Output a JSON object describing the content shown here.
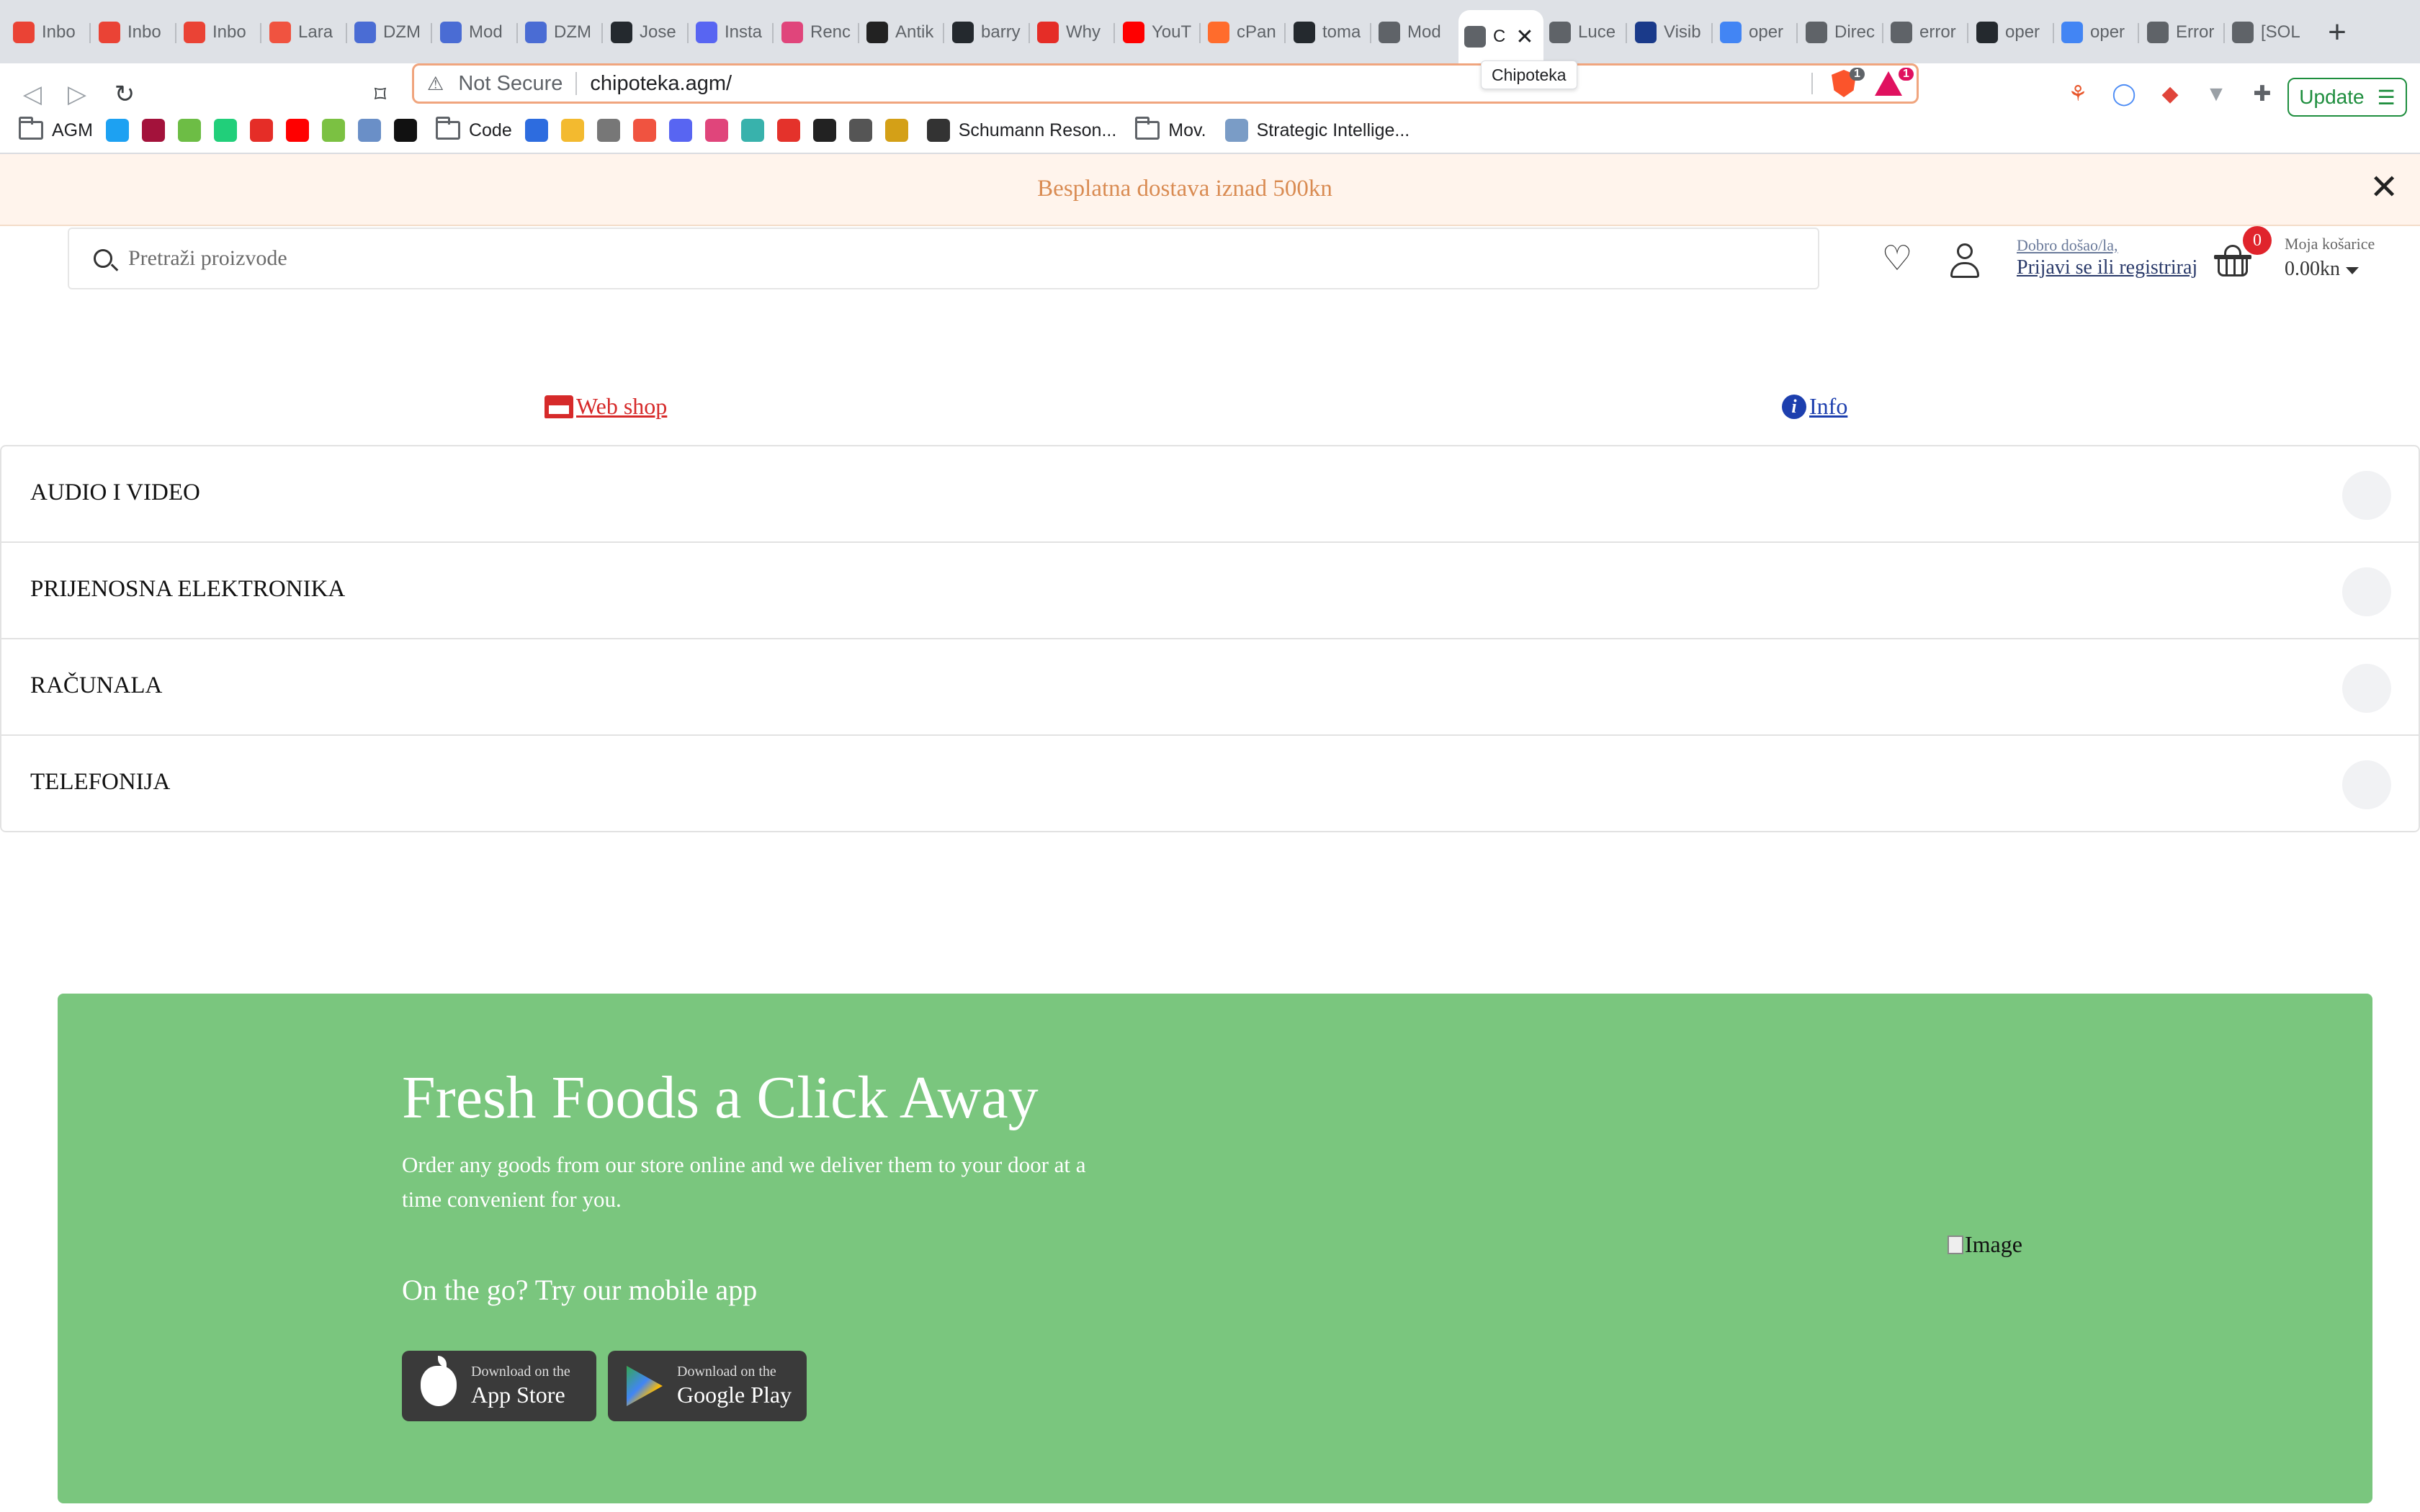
{
  "browser": {
    "tabs": [
      {
        "label": "Inbo",
        "icon": "gmail-icon",
        "color": "#ea4335"
      },
      {
        "label": "Inbo",
        "icon": "gmail-icon",
        "color": "#ea4335"
      },
      {
        "label": "Inbo",
        "icon": "gmail-icon",
        "color": "#ea4335"
      },
      {
        "label": "Lara",
        "icon": "laravel-icon",
        "color": "#f05340"
      },
      {
        "label": "DZM",
        "icon": "stack-icon",
        "color": "#4a6cd4"
      },
      {
        "label": "Mod",
        "icon": "stack-icon",
        "color": "#4a6cd4"
      },
      {
        "label": "DZM",
        "icon": "stack-icon",
        "color": "#4a6cd4"
      },
      {
        "label": "Jose",
        "icon": "github-icon",
        "color": "#24292e"
      },
      {
        "label": "Insta",
        "icon": "planet-icon",
        "color": "#5865f2"
      },
      {
        "label": "Renc",
        "icon": "balloon-icon",
        "color": "#e0457b"
      },
      {
        "label": "Antik",
        "icon": "chart-icon",
        "color": "#222222"
      },
      {
        "label": "barry",
        "icon": "github-icon",
        "color": "#24292e"
      },
      {
        "label": "Why",
        "icon": "c-icon",
        "color": "#e52d27"
      },
      {
        "label": "YouT",
        "icon": "youtube-icon",
        "color": "#ff0000"
      },
      {
        "label": "cPan",
        "icon": "cpanel-icon",
        "color": "#ff6c2c"
      },
      {
        "label": "toma",
        "icon": "github-icon",
        "color": "#24292e"
      },
      {
        "label": "Mod",
        "icon": "globe-icon",
        "color": "#5f6368"
      },
      {
        "label": "C",
        "icon": "cart-icon",
        "color": "#5f6368",
        "active": true
      },
      {
        "label": "Luce",
        "icon": "globe-icon",
        "color": "#5f6368"
      },
      {
        "label": "Visib",
        "icon": "f-icon",
        "color": "#1a3a8a"
      },
      {
        "label": "oper",
        "icon": "google-icon",
        "color": "#4285f4"
      },
      {
        "label": "Direc",
        "icon": "globe-icon",
        "color": "#5f6368"
      },
      {
        "label": "error",
        "icon": "globe-icon",
        "color": "#5f6368"
      },
      {
        "label": "oper",
        "icon": "github-icon",
        "color": "#24292e"
      },
      {
        "label": "oper",
        "icon": "google-icon",
        "color": "#4285f4"
      },
      {
        "label": "Error",
        "icon": "globe-icon",
        "color": "#5f6368"
      },
      {
        "label": "[SOL",
        "icon": "globe-icon",
        "color": "#5f6368"
      }
    ],
    "tooltip": "Chipoteka",
    "security_label": "Not Secure",
    "url": "chipoteka.agm/",
    "brave_shield_count": "1",
    "brave_rewards_count": "1",
    "update_label": "Update",
    "bookmarks": [
      {
        "label": "AGM",
        "icon": "folder-icon"
      },
      {
        "label": "",
        "icon": "twitter-icon",
        "color": "#1da1f2"
      },
      {
        "label": "",
        "icon": "gem-icon",
        "color": "#a3123b"
      },
      {
        "label": "",
        "icon": "g-icon",
        "color": "#6dbd45"
      },
      {
        "label": "",
        "icon": "gab-icon",
        "color": "#21cf7a"
      },
      {
        "label": "",
        "icon": "c-icon",
        "color": "#e52d27"
      },
      {
        "label": "",
        "icon": "youtube-icon",
        "color": "#ff0000"
      },
      {
        "label": "",
        "icon": "play-icon",
        "color": "#7bc142"
      },
      {
        "label": "",
        "icon": "globe-icon",
        "color": "#6a8fc7"
      },
      {
        "label": "",
        "icon": "theta-icon",
        "color": "#111111"
      },
      {
        "label": "Code",
        "icon": "folder-icon"
      },
      {
        "label": "",
        "icon": "c-icon",
        "color": "#2d6cdf"
      },
      {
        "label": "",
        "icon": "binance-icon",
        "color": "#f3ba2f"
      },
      {
        "label": "",
        "icon": "stack-icon",
        "color": "#777777"
      },
      {
        "label": "",
        "icon": "laravel-icon",
        "color": "#f05340"
      },
      {
        "label": "",
        "icon": "planet-icon",
        "color": "#5865f2"
      },
      {
        "label": "",
        "icon": "balloon-icon",
        "color": "#e0457b"
      },
      {
        "label": "",
        "icon": "tailwind-icon",
        "color": "#38b2ac"
      },
      {
        "label": "",
        "icon": "in-icon",
        "color": "#e4322b"
      },
      {
        "label": "",
        "icon": "printer-icon",
        "color": "#222222"
      },
      {
        "label": "",
        "icon": "pin-icon",
        "color": "#555555"
      },
      {
        "label": "",
        "icon": "link-icon",
        "color": "#d4a017"
      },
      {
        "label": "Schumann Reson...",
        "icon": "mercedes-icon",
        "color": "#333333"
      },
      {
        "label": "Mov.",
        "icon": "folder-icon"
      },
      {
        "label": "Strategic Intellige...",
        "icon": "wave-icon",
        "color": "#7a9cc6"
      }
    ]
  },
  "promo": {
    "text": "Besplatna dostava iznad 500kn",
    "color": "#d98b52",
    "background": "#fff4ec"
  },
  "header": {
    "search_placeholder": "Pretraži proizvode",
    "welcome": "Dobro došao/la,",
    "login": "Prijavi se ili registriraj",
    "cart_count": "0",
    "cart_label": "Moja košarice",
    "cart_total": "0.00kn"
  },
  "nav": {
    "shop": "Web shop",
    "info": "Info"
  },
  "categories": [
    "AUDIO I VIDEO",
    "PRIJENOSNA ELEKTRONIKA",
    "RAČUNALA",
    "TELEFONIJA"
  ],
  "banner": {
    "title": "Fresh Foods a Click Away",
    "description": "Order any goods from our store online and we deliver them to your door at a time convenient for you.",
    "subtitle": "On the go? Try our mobile app",
    "app_store_small": "Download on the",
    "app_store_big": "App Store",
    "google_play_small": "Download on the",
    "google_play_big": "Google Play",
    "image_alt": "Image",
    "background": "#7ac67e"
  }
}
